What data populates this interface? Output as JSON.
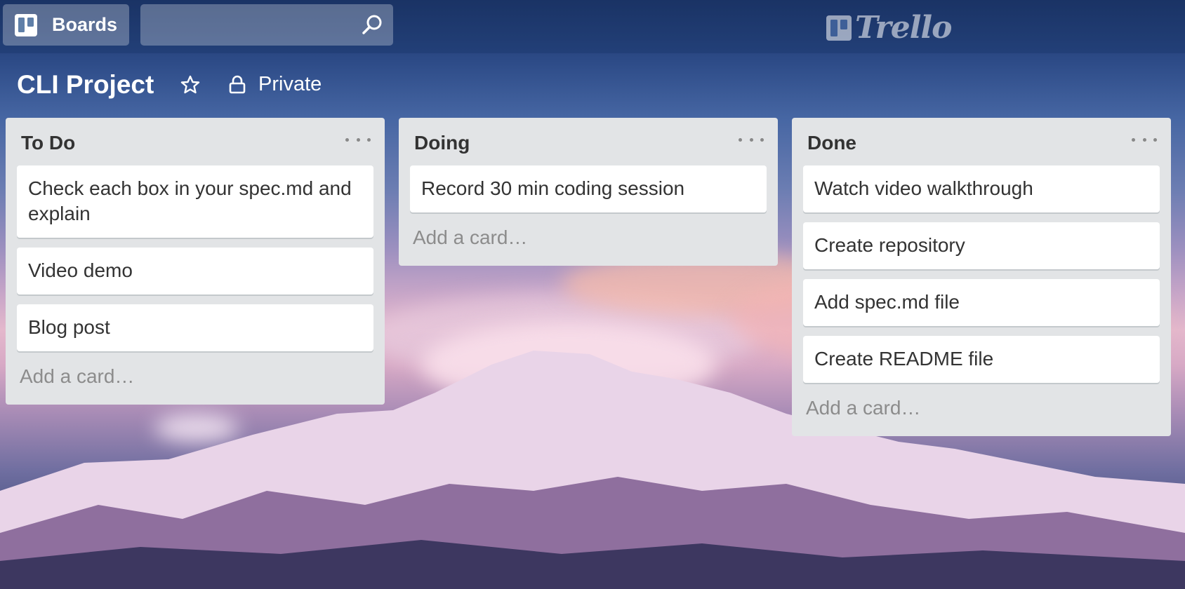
{
  "header": {
    "boards_label": "Boards",
    "search_placeholder": "",
    "logo_text": "Trello"
  },
  "board": {
    "title": "CLI Project",
    "visibility_label": "Private"
  },
  "lists": [
    {
      "title": "To Do",
      "cards": [
        "Check each box in your spec.md and explain",
        "Video demo",
        "Blog post"
      ],
      "add_card_label": "Add a card…"
    },
    {
      "title": "Doing",
      "cards": [
        "Record 30 min coding session"
      ],
      "add_card_label": "Add a card…"
    },
    {
      "title": "Done",
      "cards": [
        "Watch video walkthrough",
        "Create repository",
        "Add spec.md file",
        "Create README file"
      ],
      "add_card_label": "Add a card…"
    }
  ],
  "colors": {
    "list_bg": "#e2e4e6",
    "card_bg": "#ffffff",
    "header_button_bg": "rgba(255,255,255,0.28)"
  }
}
